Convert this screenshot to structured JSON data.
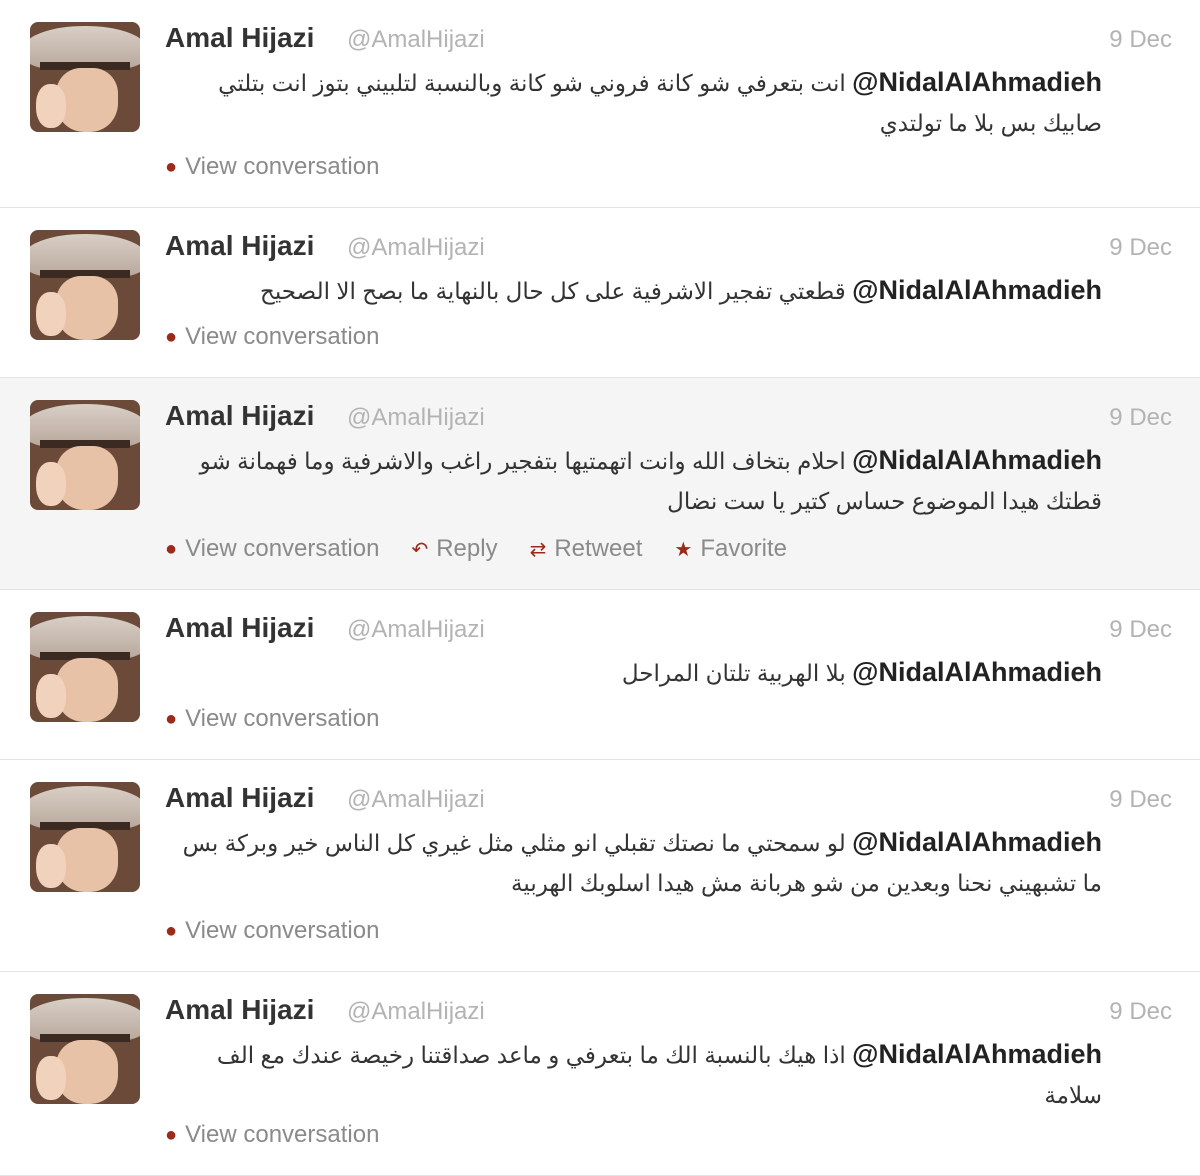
{
  "tweets": [
    {
      "name": "Amal Hijazi",
      "handle": "@AmalHijazi",
      "time": "9 Dec",
      "mention": "@NidalAlAhmadieh",
      "text": "انت بتعرفي شو كانة فروني شو كانة وبالنسبة لتلبيني بتوز انت بتلتي صابيك بس بلا ما تولتدي",
      "actions": [
        "View conversation"
      ]
    },
    {
      "name": "Amal Hijazi",
      "handle": "@AmalHijazi",
      "time": "9 Dec",
      "mention": "@NidalAlAhmadieh",
      "text": "قطعتي تفجير الاشرفية على كل حال بالنهاية ما بصح الا الصحيح",
      "actions": [
        "View conversation"
      ]
    },
    {
      "name": "Amal Hijazi",
      "handle": "@AmalHijazi",
      "time": "9 Dec",
      "mention": "@NidalAlAhmadieh",
      "text": "احلام بتخاف الله وانت اتهمتيها بتفجير راغب والاشرفية وما فهمانة شو قطتك هيدا الموضوع حساس كتير يا ست نضال",
      "actions": [
        "View conversation",
        "Reply",
        "Retweet",
        "Favorite"
      ]
    },
    {
      "name": "Amal Hijazi",
      "handle": "@AmalHijazi",
      "time": "9 Dec",
      "mention": "@NidalAlAhmadieh",
      "text": "بلا الهربية تلتان المراحل",
      "actions": [
        "View conversation"
      ]
    },
    {
      "name": "Amal Hijazi",
      "handle": "@AmalHijazi",
      "time": "9 Dec",
      "mention": "@NidalAlAhmadieh",
      "text": "لو سمحتي ما نصتك تقبلي انو مثلي مثل غيري كل الناس خير وبركة بس ما تشبهيني نحنا وبعدين من شو هربانة مش هيدا اسلوبك الهربية",
      "actions": [
        "View conversation"
      ]
    },
    {
      "name": "Amal Hijazi",
      "handle": "@AmalHijazi",
      "time": "9 Dec",
      "mention": "@NidalAlAhmadieh",
      "text": "اذا هيك بالنسبة الك ما بتعرفي و ماعد صداقتنا رخيصة عندك مع الف سلامة",
      "actions": [
        "View conversation"
      ]
    }
  ],
  "icons": {
    "View conversation": "speech-bubble-icon",
    "Reply": "reply-arrow-icon",
    "Retweet": "retweet-icon",
    "Favorite": "star-icon"
  },
  "colors": {
    "icon": "#9b2a1a",
    "muted": "#b3b3b3",
    "text": "#333333",
    "highlight_bg": "#f5f5f5"
  }
}
